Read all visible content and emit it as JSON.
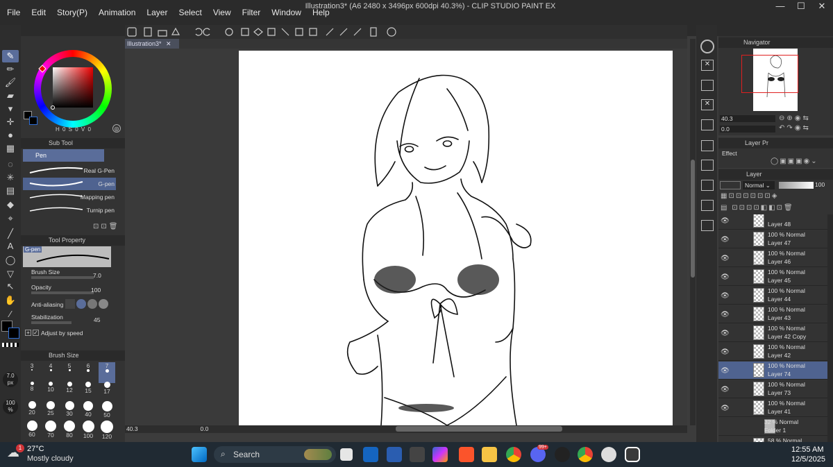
{
  "app": {
    "title": "Illustration3* (A6 2480 x 3496px 600dpi 40.3%) - CLIP STUDIO PAINT EX"
  },
  "menu": [
    "File",
    "Edit",
    "Story(P)",
    "Animation",
    "Layer",
    "Select",
    "View",
    "Filter",
    "Window",
    "Help"
  ],
  "doc_tab": "Illustration3*",
  "color": {
    "hsv": "H 0  S 0  V 0",
    "h": "0",
    "s": "0",
    "v": "0"
  },
  "subtool": {
    "header": "Sub Tool",
    "group": "Pen",
    "brushes": [
      "Real G-Pen",
      "G-pen",
      "Mapping pen",
      "Turnip pen"
    ]
  },
  "toolprop": {
    "header": "Tool Property",
    "preview": "G-pen",
    "brush_size_label": "Brush Size",
    "brush_size": "7.0",
    "opacity_label": "Opacity",
    "opacity": "100",
    "aa_label": "Anti-aliasing",
    "stab_label": "Stabilization",
    "stab": "45",
    "adjust_label": "Adjust by speed"
  },
  "brushsize": {
    "header": "Brush Size",
    "row1": [
      "3",
      "4",
      "5",
      "6",
      "7"
    ],
    "row2": [
      "8",
      "10",
      "12",
      "15",
      "17"
    ],
    "row3": [
      "20",
      "25",
      "30",
      "40",
      "50"
    ],
    "row4": [
      "60",
      "70",
      "80",
      "100",
      "120"
    ]
  },
  "indicator": {
    "size": "7.0",
    "unit": "px",
    "opacity": "100",
    "pct": "%"
  },
  "status": {
    "zoom": "40.3",
    "rotate": "0.0"
  },
  "navigator": {
    "header": "Navigator",
    "zoom": "40.3",
    "angle": "0.0"
  },
  "layerprop": {
    "header": "Layer Pr",
    "effect": "Effect"
  },
  "layers": {
    "header": "Layer",
    "blend": "Normal",
    "opacity": "100",
    "rows": [
      {
        "top": "",
        "name": "Layer 48"
      },
      {
        "top": "100 % Normal",
        "name": "Layer 47"
      },
      {
        "top": "100 % Normal",
        "name": "Layer 46"
      },
      {
        "top": "100 % Normal",
        "name": "Layer 45"
      },
      {
        "top": "100 % Normal",
        "name": "Layer 44"
      },
      {
        "top": "100 % Normal",
        "name": "Layer 43"
      },
      {
        "top": "100 % Normal",
        "name": "Layer 42 Copy"
      },
      {
        "top": "100 % Normal",
        "name": "Layer 42"
      },
      {
        "top": "100 % Normal",
        "name": "Layer 74"
      },
      {
        "top": "100 % Normal",
        "name": "Layer 73"
      },
      {
        "top": "100 % Normal",
        "name": "Layer 41"
      },
      {
        "top": "32 % Normal",
        "name": "Folder 1"
      },
      {
        "top": "58 % Normal",
        "name": ""
      }
    ]
  },
  "taskbar": {
    "temp": "27°C",
    "weather": "Mostly cloudy",
    "search": "Search",
    "time": "12:55 AM",
    "date": "12/5/2025",
    "badge": "1",
    "notif1": "99+"
  },
  "colors": {
    "accent": "#5a6d9a",
    "selected_layer": "#4f6390"
  }
}
